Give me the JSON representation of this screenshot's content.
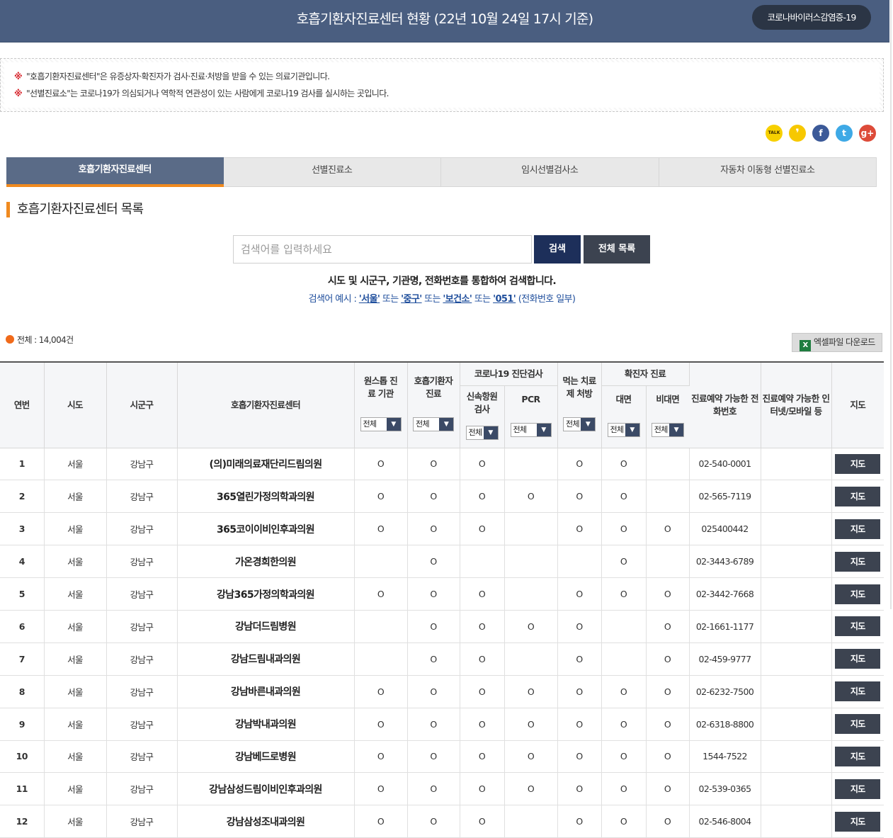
{
  "header": {
    "title": "호흡기환자진료센터 현황 (22년 10월 24일 17시 기준)",
    "badge": "코로나바이러스감염증-19"
  },
  "notice": {
    "mark": "※",
    "lines": [
      "\"호흡기환자진료센터\"은 유증상자·확진자가 검사·진료·처방을 받을 수 있는 의료기관입니다.",
      "\"선별진료소\"는 코로나19가 의심되거나 역학적 연관성이 있는 사람에게 코로나19 검사를 실시하는 곳입니다."
    ]
  },
  "sns": [
    {
      "name": "kakaotalk-icon",
      "glyph": "TALK",
      "color": "#f7d000"
    },
    {
      "name": "kakaostory-icon",
      "glyph": "❜",
      "color": "#f7c800"
    },
    {
      "name": "facebook-icon",
      "glyph": "f",
      "color": "#3b5998"
    },
    {
      "name": "twitter-icon",
      "glyph": "t",
      "color": "#3ea9e6"
    },
    {
      "name": "googleplus-icon",
      "glyph": "g+",
      "color": "#dd4b39"
    }
  ],
  "tabs": [
    "호흡기환자진료센터",
    "선별진료소",
    "임시선별검사소",
    "자동차 이동형 선별진료소"
  ],
  "section_title": "호흡기환자진료센터 목록",
  "search": {
    "placeholder": "검색어를 입력하세요",
    "search_label": "검색",
    "all_label": "전체 목록",
    "help": "시도 및 시군구, 기관명, 전화번호를 통합하여 검색합니다.",
    "example_prefix": "검색어 예시 :",
    "ex1": "'서울'",
    "or1": "또는",
    "ex2": "'중구'",
    "or2": "또는",
    "ex3": "'보건소'",
    "or3": "또는",
    "ex4": "'051'",
    "example_suffix": "(전화번호 일부)"
  },
  "total": "전체 : 14,004건",
  "excel_label": "엑셀파일 다운로드",
  "table": {
    "headers": {
      "no": "연번",
      "sido": "시도",
      "sigungu": "시군구",
      "center": "호흡기환자진료센터",
      "onestop": "원스톱 진료 기관",
      "resp": "호흡기환자 진료",
      "covid_test": "코로나19 진단검사",
      "rat": "신속항원 검사",
      "pcr": "PCR",
      "oral": "먹는 치료제 처방",
      "confirmed": "확진자 진료",
      "face": "대면",
      "nonface": "비대면",
      "phone": "진료예약 가능한 전화번호",
      "online": "진료예약 가능한 인터넷/모바일 등",
      "map": "지도"
    },
    "filter_label": "전체",
    "map_label": "지도",
    "rows": [
      {
        "no": "1",
        "sido": "서울",
        "sigungu": "강남구",
        "name": "(의)미래의료재단리드림의원",
        "onestop": "O",
        "resp": "O",
        "rat": "O",
        "pcr": "",
        "oral": "O",
        "face": "O",
        "nonface": "",
        "phone": "02-540-0001",
        "online": ""
      },
      {
        "no": "2",
        "sido": "서울",
        "sigungu": "강남구",
        "name": "365열린가정의학과의원",
        "onestop": "O",
        "resp": "O",
        "rat": "O",
        "pcr": "O",
        "oral": "O",
        "face": "O",
        "nonface": "",
        "phone": "02-565-7119",
        "online": ""
      },
      {
        "no": "3",
        "sido": "서울",
        "sigungu": "강남구",
        "name": "365코이이비인후과의원",
        "onestop": "O",
        "resp": "O",
        "rat": "O",
        "pcr": "",
        "oral": "O",
        "face": "O",
        "nonface": "O",
        "phone": "025400442",
        "online": ""
      },
      {
        "no": "4",
        "sido": "서울",
        "sigungu": "강남구",
        "name": "가온경희한의원",
        "onestop": "",
        "resp": "O",
        "rat": "",
        "pcr": "",
        "oral": "",
        "face": "O",
        "nonface": "",
        "phone": "02-3443-6789",
        "online": ""
      },
      {
        "no": "5",
        "sido": "서울",
        "sigungu": "강남구",
        "name": "강남365가정의학과의원",
        "onestop": "O",
        "resp": "O",
        "rat": "O",
        "pcr": "",
        "oral": "O",
        "face": "O",
        "nonface": "O",
        "phone": "02-3442-7668",
        "online": ""
      },
      {
        "no": "6",
        "sido": "서울",
        "sigungu": "강남구",
        "name": "강남더드림병원",
        "onestop": "",
        "resp": "O",
        "rat": "O",
        "pcr": "O",
        "oral": "O",
        "face": "",
        "nonface": "O",
        "phone": "02-1661-1177",
        "online": ""
      },
      {
        "no": "7",
        "sido": "서울",
        "sigungu": "강남구",
        "name": "강남드림내과의원",
        "onestop": "",
        "resp": "O",
        "rat": "O",
        "pcr": "",
        "oral": "O",
        "face": "",
        "nonface": "O",
        "phone": "02-459-9777",
        "online": ""
      },
      {
        "no": "8",
        "sido": "서울",
        "sigungu": "강남구",
        "name": "강남바른내과의원",
        "onestop": "O",
        "resp": "O",
        "rat": "O",
        "pcr": "O",
        "oral": "O",
        "face": "O",
        "nonface": "O",
        "phone": "02-6232-7500",
        "online": ""
      },
      {
        "no": "9",
        "sido": "서울",
        "sigungu": "강남구",
        "name": "강남박내과의원",
        "onestop": "O",
        "resp": "O",
        "rat": "O",
        "pcr": "O",
        "oral": "O",
        "face": "O",
        "nonface": "O",
        "phone": "02-6318-8800",
        "online": ""
      },
      {
        "no": "10",
        "sido": "서울",
        "sigungu": "강남구",
        "name": "강남베드로병원",
        "onestop": "O",
        "resp": "O",
        "rat": "O",
        "pcr": "O",
        "oral": "O",
        "face": "O",
        "nonface": "O",
        "phone": "1544-7522",
        "online": ""
      },
      {
        "no": "11",
        "sido": "서울",
        "sigungu": "강남구",
        "name": "강남삼성드림이비인후과의원",
        "onestop": "O",
        "resp": "O",
        "rat": "O",
        "pcr": "O",
        "oral": "O",
        "face": "O",
        "nonface": "O",
        "phone": "02-539-0365",
        "online": ""
      },
      {
        "no": "12",
        "sido": "서울",
        "sigungu": "강남구",
        "name": "강남삼성조내과의원",
        "onestop": "O",
        "resp": "O",
        "rat": "O",
        "pcr": "",
        "oral": "O",
        "face": "O",
        "nonface": "O",
        "phone": "02-546-8004",
        "online": ""
      }
    ]
  }
}
